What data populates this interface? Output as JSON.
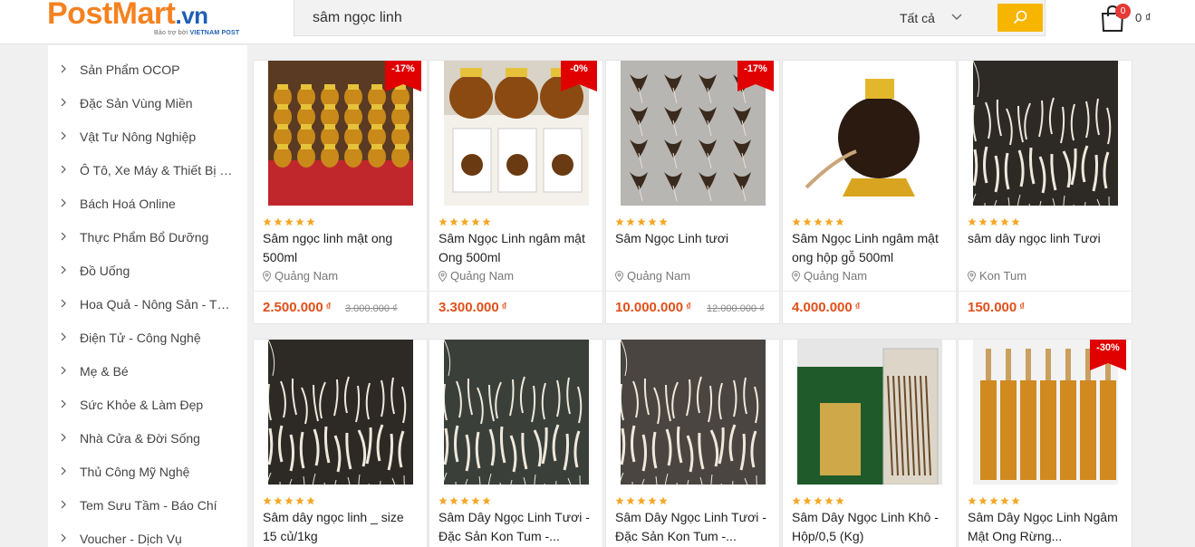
{
  "header": {
    "logo_main": "PostMart",
    "logo_tld": ".vn",
    "logo_sub_small": "Bảo trợ bởi",
    "logo_sub": "VIETNAM POST",
    "search_value": "sâm ngọc linh",
    "search_category": "Tất cả",
    "cart_count": "0",
    "cart_total": "0 ₫"
  },
  "sidebar": {
    "items": [
      {
        "label": "Sản Phẩm OCOP"
      },
      {
        "label": "Đặc Sản Vùng Miền"
      },
      {
        "label": "Vật Tư Nông Nghiệp"
      },
      {
        "label": "Ô Tô, Xe Máy & Thiết Bị Định Vị"
      },
      {
        "label": "Bách Hoá Online"
      },
      {
        "label": "Thực Phẩm Bổ Dưỡng"
      },
      {
        "label": "Đồ Uống"
      },
      {
        "label": "Hoa Quả - Nông Sản - Thực Phẩm"
      },
      {
        "label": "Điện Tử - Công Nghệ"
      },
      {
        "label": "Mẹ & Bé"
      },
      {
        "label": "Sức Khỏe & Làm Đẹp"
      },
      {
        "label": "Nhà Cửa & Đời Sống"
      },
      {
        "label": "Thủ Công Mỹ Nghệ"
      },
      {
        "label": "Tem Sưu Tầm - Báo Chí"
      },
      {
        "label": "Voucher - Dịch Vụ"
      }
    ]
  },
  "products": [
    {
      "name": "Sâm ngọc linh mật ong 500ml",
      "location": "Quảng Nam",
      "price": "2.500.000",
      "old_price": "3.000.000 ₫",
      "discount": "-17%",
      "rating": 5
    },
    {
      "name": "Sâm Ngọc Linh ngâm mật Ong 500ml",
      "location": "Quảng Nam",
      "price": "3.300.000",
      "old_price": "",
      "discount": "-0%",
      "rating": 5
    },
    {
      "name": "Sâm Ngọc Linh tươi",
      "location": "Quảng Nam",
      "price": "10.000.000",
      "old_price": "12.000.000 ₫",
      "discount": "-17%",
      "rating": 5
    },
    {
      "name": "Sâm Ngọc Linh ngâm mật ong hộp gỗ 500ml",
      "location": "Quảng Nam",
      "price": "4.000.000",
      "old_price": "",
      "discount": "",
      "rating": 5
    },
    {
      "name": "sâm dây ngọc linh Tươi",
      "location": "Kon Tum",
      "price": "150.000",
      "old_price": "",
      "discount": "",
      "rating": 5
    },
    {
      "name": "Sâm dây ngọc linh _ size 15 củ/1kg",
      "location": "",
      "price": "",
      "old_price": "",
      "discount": "",
      "rating": 5
    },
    {
      "name": "Sâm Dây Ngọc Linh Tươi - Đặc Sản Kon Tum -...",
      "location": "",
      "price": "",
      "old_price": "",
      "discount": "",
      "rating": 5
    },
    {
      "name": "Sâm Dây Ngọc Linh Tươi - Đặc Sản Kon Tum -...",
      "location": "",
      "price": "",
      "old_price": "",
      "discount": "",
      "rating": 5
    },
    {
      "name": "Sâm Dây Ngọc Linh Khô - Hộp/0,5 (Kg)",
      "location": "",
      "price": "",
      "old_price": "",
      "discount": "",
      "rating": 5
    },
    {
      "name": "Sâm Dây Ngọc Linh Ngâm Mật Ong Rừng...",
      "location": "",
      "price": "",
      "old_price": "",
      "discount": "-30%",
      "rating": 5
    }
  ],
  "currency_symbol": "₫",
  "colors": {
    "brand_orange": "#f58220",
    "brand_blue": "#1e5fb4",
    "search_button": "#f7b500",
    "price": "#e0501a",
    "discount_badge": "#e00000",
    "star": "#f5a623"
  },
  "icons": {
    "search": "search-icon",
    "cart": "shopping-bag-icon",
    "chevron": "chevron-right-icon",
    "location": "map-pin-icon",
    "dropdown": "chevron-down-icon"
  }
}
